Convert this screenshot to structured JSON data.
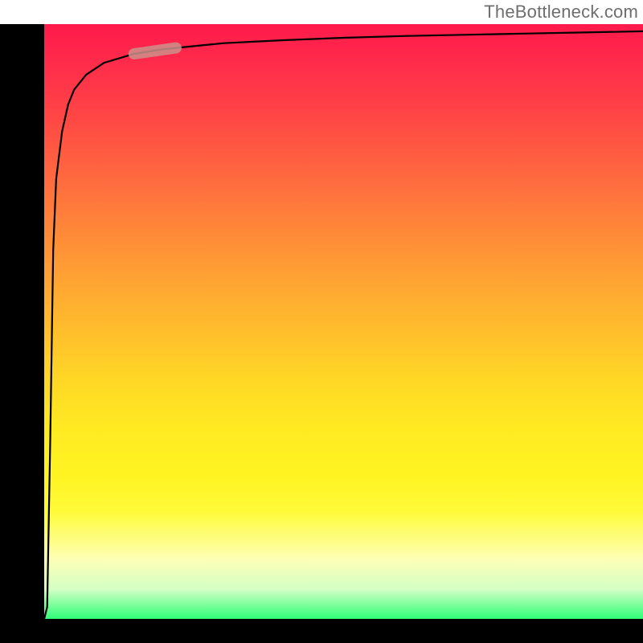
{
  "watermark": "TheBottleneck.com",
  "chart_data": {
    "type": "line",
    "title": "",
    "xlabel": "",
    "ylabel": "",
    "xlim": [
      0,
      100
    ],
    "ylim": [
      0,
      100
    ],
    "grid": false,
    "series": [
      {
        "name": "curve",
        "x": [
          0.0,
          0.5,
          1.0,
          1.5,
          2.0,
          3.0,
          4.0,
          5.0,
          7.0,
          10.0,
          15.0,
          20.0,
          30.0,
          40.0,
          50.0,
          60.0,
          70.0,
          80.0,
          90.0,
          100.0
        ],
        "y": [
          0.0,
          2.0,
          30.0,
          62.0,
          74.0,
          82.0,
          86.5,
          89.0,
          91.5,
          93.5,
          95.0,
          95.8,
          96.8,
          97.3,
          97.7,
          98.0,
          98.2,
          98.4,
          98.6,
          98.8
        ]
      }
    ],
    "highlight_segment": {
      "x_start": 15.0,
      "x_end": 22.0
    },
    "background_gradient_stops": [
      {
        "pos": 0.0,
        "color": "#ff1a4b"
      },
      {
        "pos": 0.5,
        "color": "#ffb92e"
      },
      {
        "pos": 0.8,
        "color": "#fffb3a"
      },
      {
        "pos": 0.95,
        "color": "#d4ffc5"
      },
      {
        "pos": 1.0,
        "color": "#2fff78"
      }
    ]
  }
}
